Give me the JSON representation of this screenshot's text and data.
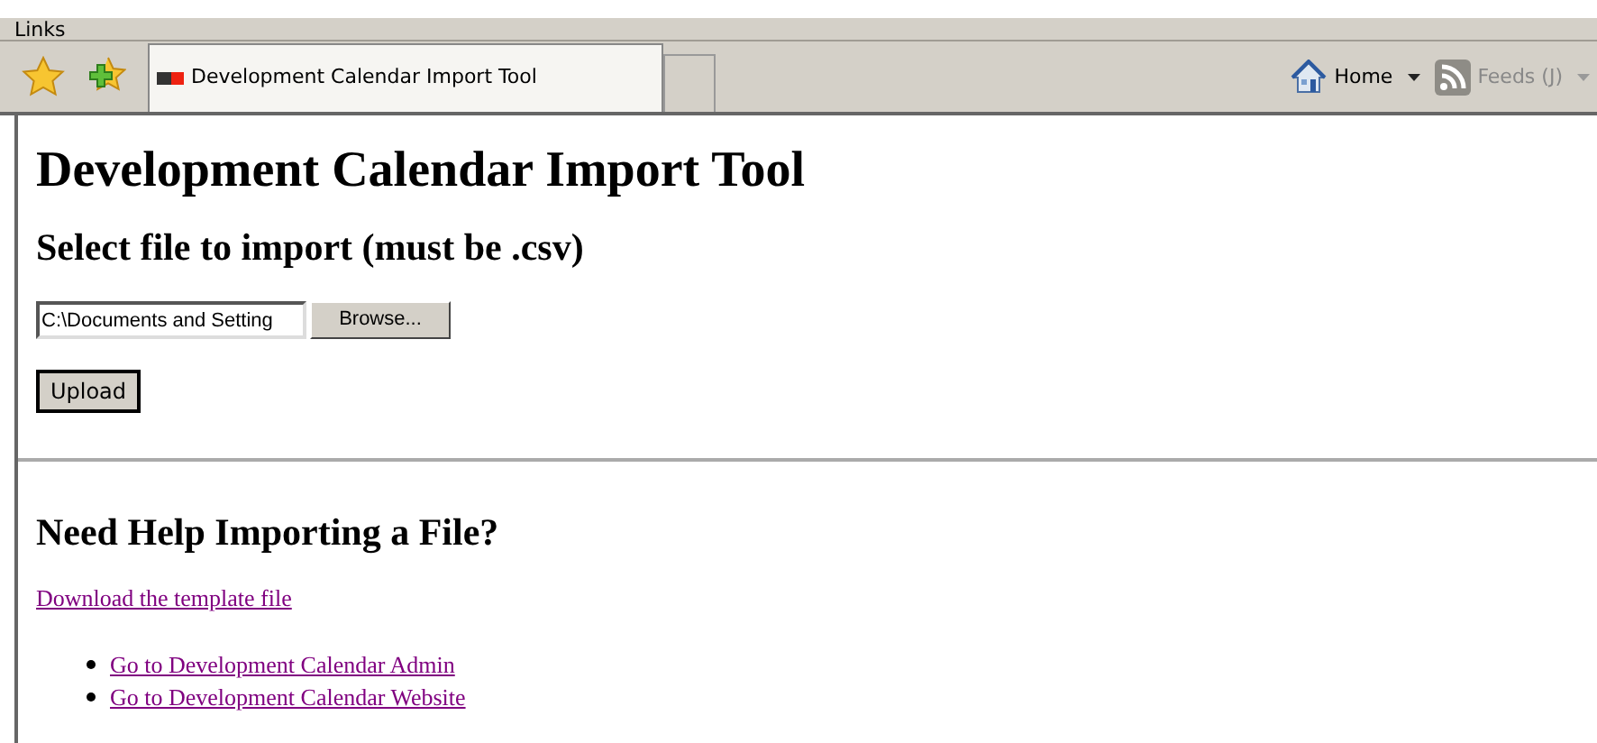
{
  "links_bar": {
    "label": "Links"
  },
  "tabs": [
    {
      "kind": "page",
      "title": "Development Calendar Import Tool",
      "selected": true
    },
    {
      "kind": "new",
      "selected": false
    }
  ],
  "command_bar": [
    {
      "kind": "home",
      "label": "Home",
      "disabled": false
    },
    {
      "kind": "feeds",
      "label": "Feeds (J)",
      "disabled": true
    }
  ],
  "page": {
    "title": "Development Calendar Import Tool",
    "subtitle": "Select file to import (must be .csv)",
    "file_field": {
      "value": "C:\\Documents and Setting"
    },
    "browse_button": "Browse...",
    "upload_button": "Upload",
    "help_heading": "Need Help Importing a File?",
    "template_link": "Download the template file",
    "links": [
      "Go to Development Calendar Admin",
      "Go to Development Calendar Website"
    ]
  }
}
